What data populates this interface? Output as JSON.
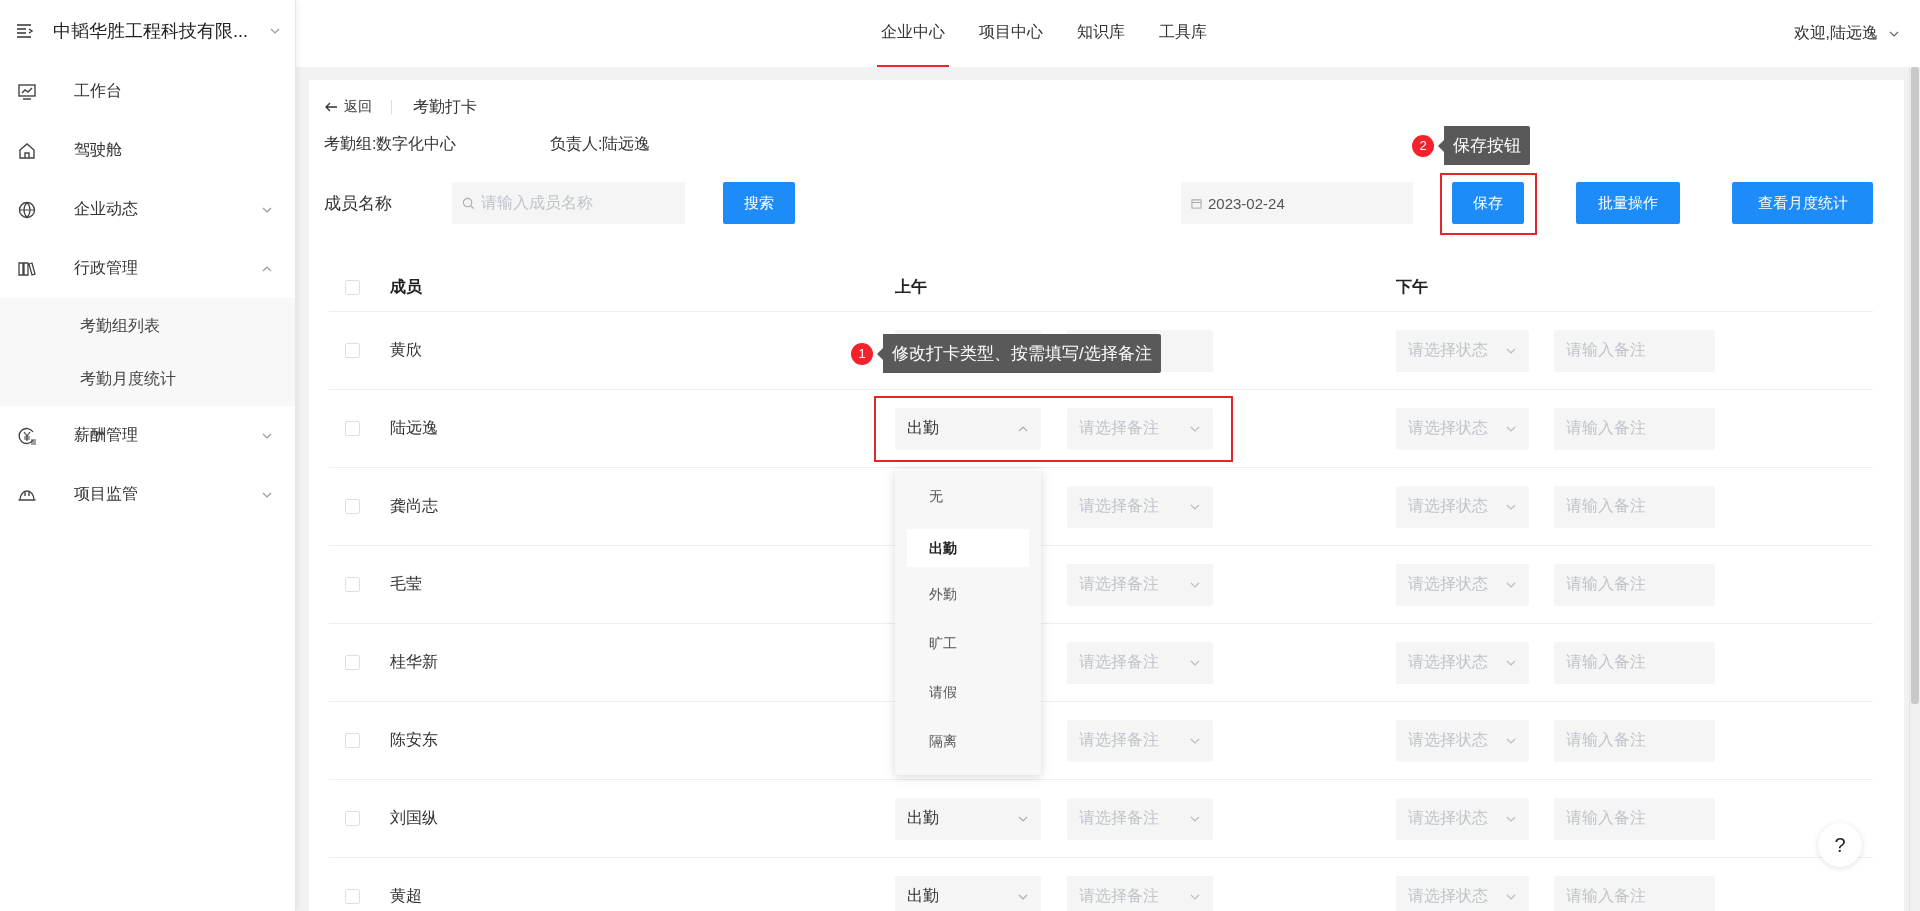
{
  "sidebar": {
    "title": "中韬华胜工程科技有限...",
    "items": [
      {
        "label": "工作台"
      },
      {
        "label": "驾驶舱"
      },
      {
        "label": "企业动态",
        "expanded": false
      },
      {
        "label": "行政管理",
        "expanded": true,
        "children": [
          {
            "label": "考勤组列表"
          },
          {
            "label": "考勤月度统计"
          }
        ]
      },
      {
        "label": "薪酬管理",
        "expanded": false
      },
      {
        "label": "项目监管",
        "expanded": false
      }
    ]
  },
  "top_nav": {
    "tabs": [
      {
        "label": "企业中心",
        "selected": true
      },
      {
        "label": "项目中心",
        "selected": false
      },
      {
        "label": "知识库",
        "selected": false
      },
      {
        "label": "工具库",
        "selected": false
      }
    ],
    "user": "欢迎,陆远逸"
  },
  "page": {
    "back": "返回",
    "title": "考勤打卡",
    "group": "考勤组:数字化中心",
    "owner": "负责人:陆远逸",
    "search_label": "成员名称",
    "search_placeholder": "请输入成员名称",
    "search_button": "搜索",
    "date": "2023-02-24",
    "buttons": [
      {
        "label": "保存",
        "highlighted": true
      },
      {
        "label": "批量操作",
        "highlighted": false
      },
      {
        "label": "查看月度统计",
        "highlighted": false
      }
    ]
  },
  "table": {
    "all_checked": false,
    "columns": [
      "成员",
      "上午",
      "下午"
    ],
    "rows": [
      {
        "name": "黄欣",
        "checked": false,
        "highlighted": false,
        "pm_status_placeholder": "请选择状态",
        "pm_note_placeholder": "请输入备注"
      },
      {
        "name": "陆远逸",
        "checked": false,
        "highlighted": true,
        "am_status": "出勤",
        "open": true,
        "am_note_placeholder": "请选择备注",
        "pm_status_placeholder": "请选择状态",
        "pm_note_placeholder": "请输入备注",
        "options": [
          {
            "label": "无",
            "selected": false
          },
          {
            "label": "出勤",
            "selected": true
          },
          {
            "label": "外勤",
            "selected": false
          },
          {
            "label": "旷工",
            "selected": false
          },
          {
            "label": "请假",
            "selected": false
          },
          {
            "label": "隔离",
            "selected": false
          }
        ]
      },
      {
        "name": "龚尚志",
        "checked": false,
        "highlighted": false,
        "am_note_placeholder": "请选择备注",
        "pm_status_placeholder": "请选择状态",
        "pm_note_placeholder": "请输入备注"
      },
      {
        "name": "毛莹",
        "checked": false,
        "highlighted": false,
        "am_note_placeholder": "请选择备注",
        "pm_status_placeholder": "请选择状态",
        "pm_note_placeholder": "请输入备注"
      },
      {
        "name": "桂华新",
        "checked": false,
        "highlighted": false,
        "am_note_placeholder": "请选择备注",
        "pm_status_placeholder": "请选择状态",
        "pm_note_placeholder": "请输入备注"
      },
      {
        "name": "陈安东",
        "checked": false,
        "highlighted": false,
        "am_note_placeholder": "请选择备注",
        "pm_status_placeholder": "请选择状态",
        "pm_note_placeholder": "请输入备注"
      },
      {
        "name": "刘国纵",
        "checked": false,
        "highlighted": false,
        "am_status": "出勤",
        "open": false,
        "am_note_placeholder": "请选择备注",
        "pm_status_placeholder": "请选择状态",
        "pm_note_placeholder": "请输入备注"
      },
      {
        "name": "黄超",
        "checked": false,
        "highlighted": false,
        "am_status": "出勤",
        "open": false,
        "am_note_placeholder": "请选择备注",
        "pm_status_placeholder": "请选择状态",
        "pm_note_placeholder": "请输入备注"
      }
    ]
  },
  "annotations": [
    {
      "number": "1",
      "text": "修改打卡类型、按需填写/选择备注"
    },
    {
      "number": "2",
      "text": "保存按钮"
    }
  ],
  "help": "?"
}
